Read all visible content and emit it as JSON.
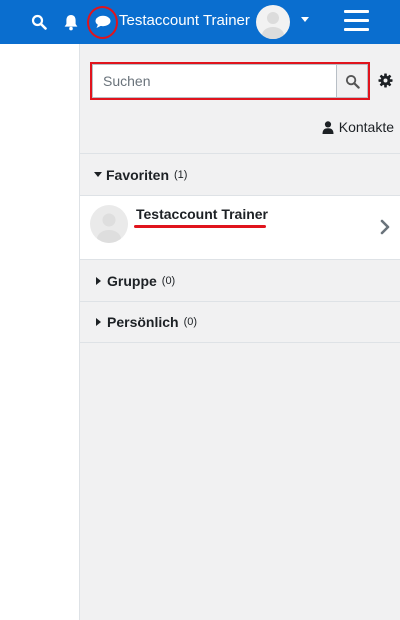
{
  "navbar": {
    "user_name": "Testaccount Trainer",
    "icons": [
      "search-icon",
      "bell-icon",
      "chat-icon",
      "hamburger-icon"
    ],
    "background": "#0a6ecf",
    "highlight_color": "#e0141d"
  },
  "drawer": {
    "search": {
      "placeholder": "Suchen",
      "value": ""
    },
    "contacts_label": "Kontakte",
    "sections": {
      "favorites": {
        "label": "Favoriten",
        "count": "(1)"
      },
      "group": {
        "label": "Gruppe",
        "count": "(0)"
      },
      "personal": {
        "label": "Persönlich",
        "count": "(0)"
      }
    },
    "favorites_items": [
      {
        "name": "Testaccount Trainer"
      }
    ]
  }
}
